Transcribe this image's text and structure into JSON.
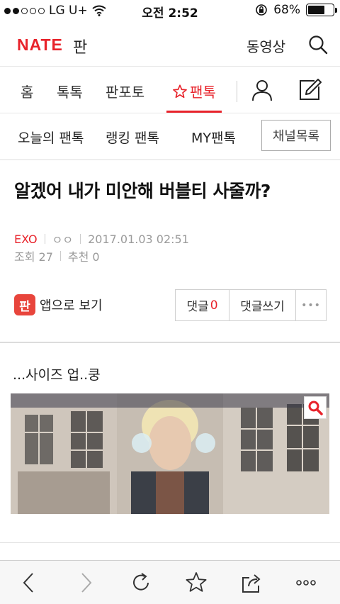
{
  "status_bar": {
    "carrier": "LG U+",
    "time": "오전 2:52",
    "battery": "68%",
    "battery_level": 0.68
  },
  "header": {
    "logo": "NATE",
    "logo_sub": "판",
    "video_label": "동영상",
    "icons": [
      "search-icon"
    ]
  },
  "nav": {
    "items": [
      "홈",
      "톡톡",
      "판포토",
      "팬톡"
    ],
    "active": "팬톡",
    "icons": [
      "star-icon",
      "person-icon",
      "write-icon"
    ]
  },
  "subnav": {
    "items": [
      "오늘의 팬톡",
      "랭킹 팬톡",
      "MY팬톡"
    ],
    "channel_button": "채널목록"
  },
  "article": {
    "title": "알겠어 내가 미안해 버블티 사줄까?",
    "category": "EXO",
    "author": "ㅇㅇ",
    "datetime": "2017.01.03 02:51",
    "views": "조회 27",
    "recommend": "추천 0",
    "app_view_icon_text": "판",
    "app_view": "앱으로 보기",
    "comment_label": "댓글",
    "comment_count": "0",
    "write_comment": "댓글쓰기",
    "more": "•••",
    "body_text": "...사이즈 업..쿵"
  },
  "toolbar": {
    "icons": [
      "back-icon",
      "forward-icon",
      "reload-icon",
      "bookmark-star-icon",
      "share-icon",
      "more-icon"
    ]
  },
  "colors": {
    "accent": "#e8232b",
    "app_icon": "#e8453c"
  }
}
